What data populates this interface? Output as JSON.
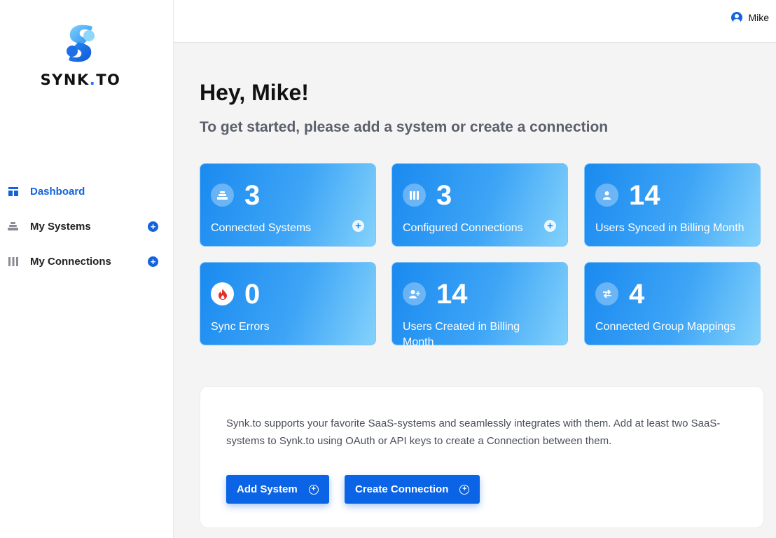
{
  "brand": {
    "name_part1": "SYNK",
    "name_dot": ".",
    "name_part2": "TO",
    "accent": "#1463dd"
  },
  "sidebar": {
    "items": [
      {
        "label": "Dashboard",
        "icon": "dashboard-icon",
        "active": true
      },
      {
        "label": "My Systems",
        "icon": "stack-icon",
        "has_add": true
      },
      {
        "label": "My Connections",
        "icon": "columns-icon",
        "has_add": true
      }
    ]
  },
  "header": {
    "user_name": "Mike",
    "user_icon": "user-circle-icon"
  },
  "main": {
    "greeting": "Hey, Mike!",
    "subtitle": "To get started, please add a system or create a connection",
    "stats": [
      {
        "value": "3",
        "label": "Connected Systems",
        "icon": "stack-icon",
        "has_add": true
      },
      {
        "value": "3",
        "label": "Configured Connections",
        "icon": "columns-icon",
        "has_add": true
      },
      {
        "value": "14",
        "label": "Users Synced in Billing Month",
        "icon": "user-icon"
      },
      {
        "value": "0",
        "label": "Sync Errors",
        "icon": "fire-icon"
      },
      {
        "value": "14",
        "label": "Users Created in Billing Month",
        "icon": "user-add-icon"
      },
      {
        "value": "4",
        "label": "Connected Group Mappings",
        "icon": "swap-icon"
      }
    ],
    "info_text": "Synk.to supports your favorite SaaS-systems and seamlessly integrates with them. Add at least two SaaS-systems to Synk.to using OAuth or API keys to create a Connection between them.",
    "buttons": {
      "add_system": "Add System",
      "create_connection": "Create Connection"
    }
  },
  "colors": {
    "card_start": "#1a8af0",
    "card_end": "#84d2fb",
    "button": "#0b63e6",
    "error_icon": "#e0312c"
  }
}
